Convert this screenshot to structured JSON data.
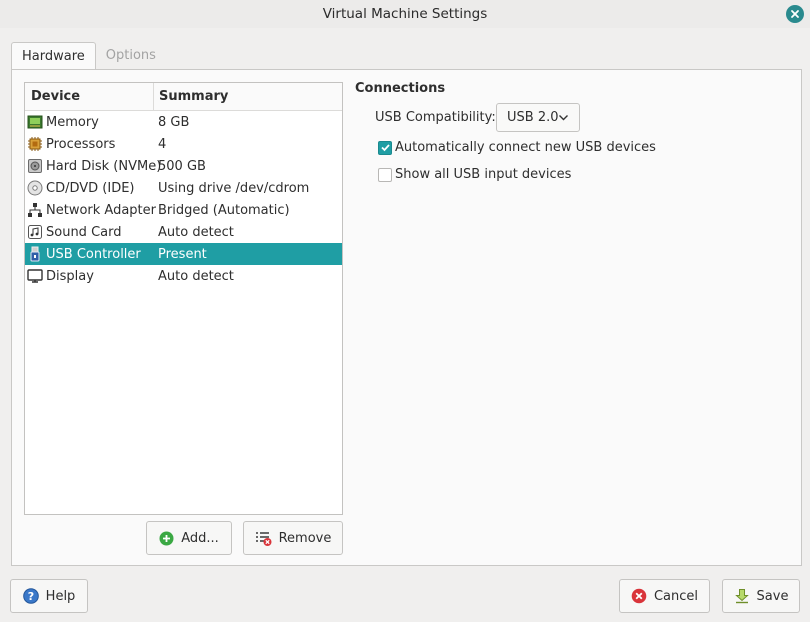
{
  "window": {
    "title": "Virtual Machine Settings"
  },
  "tabs": [
    {
      "label": "Hardware"
    },
    {
      "label": "Options"
    }
  ],
  "device_table": {
    "headers": {
      "device": "Device",
      "summary": "Summary"
    },
    "rows": [
      {
        "device": "Memory",
        "summary": "8 GB",
        "icon": "memory-icon"
      },
      {
        "device": "Processors",
        "summary": "4",
        "icon": "processor-icon"
      },
      {
        "device": "Hard Disk (NVMe)",
        "summary": "500 GB",
        "icon": "hard-disk-icon"
      },
      {
        "device": "CD/DVD (IDE)",
        "summary": "Using drive /dev/cdrom",
        "icon": "cd-dvd-icon"
      },
      {
        "device": "Network Adapter",
        "summary": "Bridged (Automatic)",
        "icon": "network-icon"
      },
      {
        "device": "Sound Card",
        "summary": "Auto detect",
        "icon": "sound-icon"
      },
      {
        "device": "USB Controller",
        "summary": "Present",
        "icon": "usb-icon",
        "selected": true
      },
      {
        "device": "Display",
        "summary": "Auto detect",
        "icon": "display-icon"
      }
    ]
  },
  "buttons": {
    "add": "Add...",
    "remove": "Remove",
    "help": "Help",
    "cancel": "Cancel",
    "save": "Save"
  },
  "connections": {
    "title": "Connections",
    "usb_compat_label": "USB Compatibility:",
    "usb_compat_value": "USB 2.0",
    "auto_connect": {
      "label": "Automatically connect new USB devices",
      "checked": true
    },
    "show_all_input": {
      "label": "Show all USB input devices",
      "checked": false
    }
  },
  "colors": {
    "accent": "#1f9ea4",
    "selection": "#1f9ea4"
  }
}
